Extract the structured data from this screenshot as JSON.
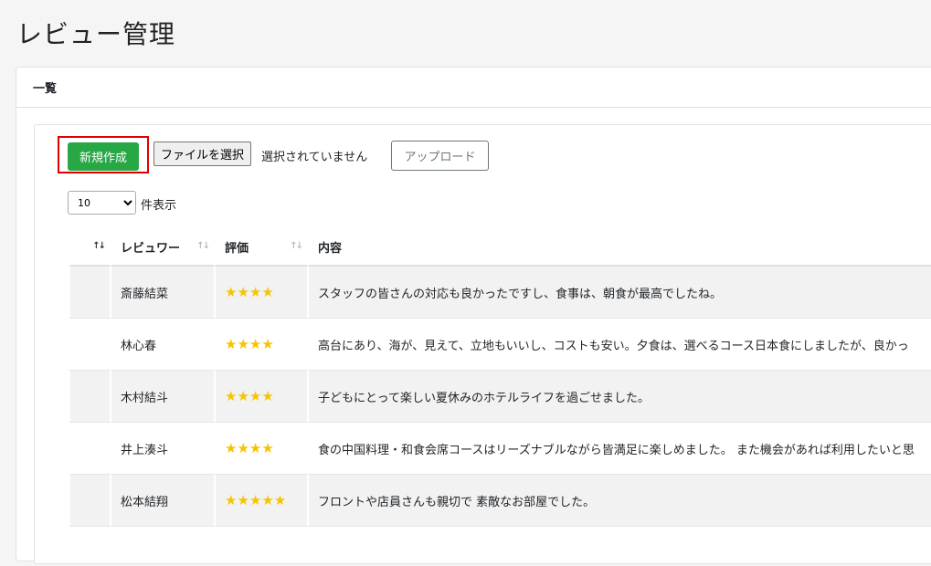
{
  "page_title": "レビュー管理",
  "card_header": "一覧",
  "toolbar": {
    "new_label": "新規作成",
    "file_button_label": "ファイルを選択",
    "file_status": "選択されていません",
    "upload_label": "アップロード"
  },
  "length_menu": {
    "selected": "10",
    "suffix": "件表示"
  },
  "table": {
    "headers": [
      "",
      "レビュワー",
      "評価",
      "内容"
    ],
    "rows": [
      {
        "name": "斎藤結菜",
        "stars": "★★★★",
        "content": "スタッフの皆さんの対応も良かったですし、食事は、朝食が最高でしたね。"
      },
      {
        "name": "林心春",
        "stars": "★★★★",
        "content": "高台にあり、海が、見えて、立地もいいし、コストも安い。夕食は、選べるコース日本食にしましたが、良かっ"
      },
      {
        "name": "木村結斗",
        "stars": "★★★★",
        "content": "子どもにとって楽しい夏休みのホテルライフを過ごせました。"
      },
      {
        "name": "井上湊斗",
        "stars": "★★★★",
        "content": "食の中国料理・和食会席コースはリーズナブルながら皆満足に楽しめました。 また機会があれば利用したいと思"
      },
      {
        "name": "松本結翔",
        "stars": "★★★★★",
        "content": "フロントや店員さんも親切で 素敵なお部屋でした。"
      }
    ]
  },
  "colors": {
    "accent_green": "#28a745",
    "star": "#f5c400",
    "highlight": "#e00000"
  }
}
